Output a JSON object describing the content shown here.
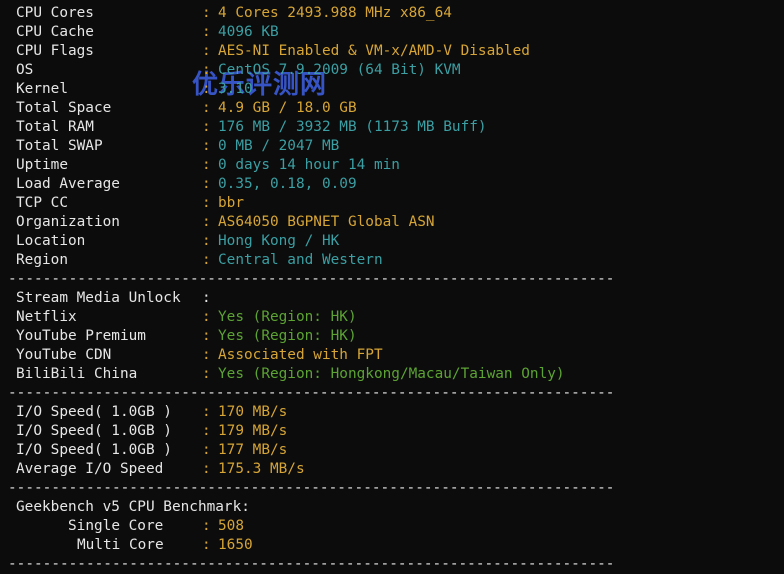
{
  "watermark": "优乐评测网",
  "top_partial": "     ",
  "sysinfo": [
    {
      "label": "CPU Cores",
      "value": "4 Cores 2493.988 MHz x86_64",
      "cls": "yel"
    },
    {
      "label": "CPU Cache",
      "value": "4096 KB",
      "cls": "teal"
    },
    {
      "label": "CPU Flags",
      "value": "AES-NI Enabled & VM-x/AMD-V Disabled",
      "cls": "yel"
    },
    {
      "label": "OS",
      "value": "CentOS 7.9.2009 (64 Bit) KVM",
      "cls": "teal"
    },
    {
      "label": "Kernel",
      "value": "3.10",
      "cls": "teal"
    },
    {
      "label": "Total Space",
      "value": "4.9 GB / 18.0 GB",
      "cls": "yel"
    },
    {
      "label": "Total RAM",
      "value": "176 MB / 3932 MB (1173 MB Buff)",
      "cls": "teal"
    },
    {
      "label": "Total SWAP",
      "value": "0 MB / 2047 MB",
      "cls": "teal"
    },
    {
      "label": "Uptime",
      "value": "0 days 14 hour 14 min",
      "cls": "teal"
    },
    {
      "label": "Load Average",
      "value": "0.35, 0.18, 0.09",
      "cls": "teal"
    },
    {
      "label": "TCP CC",
      "value": "bbr",
      "cls": "yel"
    },
    {
      "label": "Organization",
      "value": "AS64050 BGPNET Global ASN",
      "cls": "yel"
    },
    {
      "label": "Location",
      "value": "Hong Kong / HK",
      "cls": "teal"
    },
    {
      "label": "Region",
      "value": "Central and Western",
      "cls": "teal"
    }
  ],
  "separator": "----------------------------------------------------------------------",
  "stream": {
    "header": "Stream Media Unlock",
    "items": [
      {
        "label": "Netflix",
        "value": "Yes (Region: HK)",
        "cls": "green"
      },
      {
        "label": "YouTube Premium",
        "value": "Yes (Region: HK)",
        "cls": "green"
      },
      {
        "label": "YouTube CDN",
        "value": "Associated with FPT",
        "cls": "yel"
      },
      {
        "label": "BiliBili China",
        "value": "Yes (Region: Hongkong/Macau/Taiwan Only)",
        "cls": "green"
      }
    ]
  },
  "io": [
    {
      "label": "I/O Speed( 1.0GB )",
      "value": "170 MB/s"
    },
    {
      "label": "I/O Speed( 1.0GB )",
      "value": "179 MB/s"
    },
    {
      "label": "I/O Speed( 1.0GB )",
      "value": "177 MB/s"
    },
    {
      "label": "Average I/O Speed",
      "value": "175.3 MB/s"
    }
  ],
  "geekbench": {
    "header": "Geekbench v5 CPU Benchmark:",
    "items": [
      {
        "label": "Single Core",
        "value": "508"
      },
      {
        "label": "Multi Core",
        "value": "1650"
      }
    ]
  },
  "colon": ":"
}
